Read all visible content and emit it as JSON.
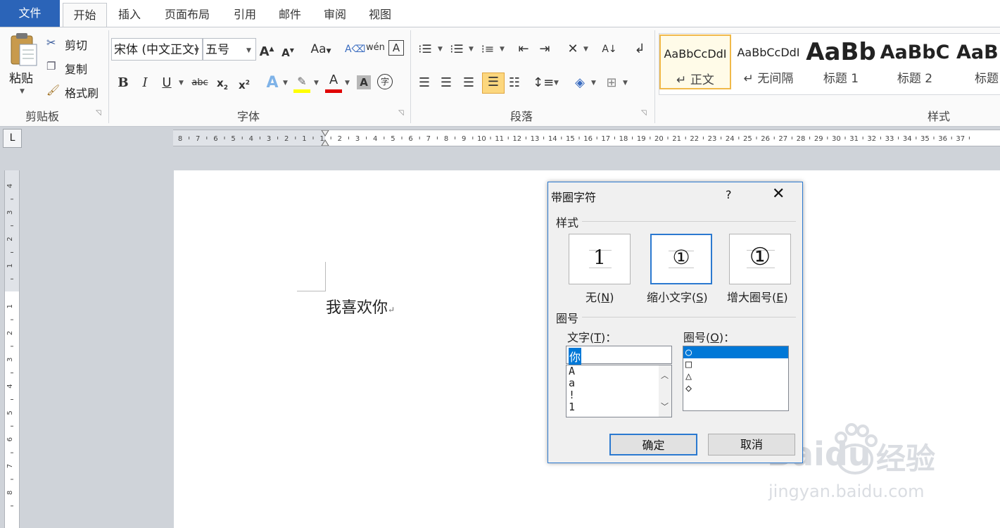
{
  "tabs": [
    "文件",
    "开始",
    "插入",
    "页面布局",
    "引用",
    "邮件",
    "审阅",
    "视图"
  ],
  "clipboard": {
    "paste": "粘贴",
    "cut": "剪切",
    "copy": "复制",
    "format_painter": "格式刷",
    "group": "剪贴板"
  },
  "font": {
    "name": "宋体 (中文正文)",
    "size": "五号",
    "group": "字体"
  },
  "paragraph": {
    "group": "段落"
  },
  "styles": {
    "group": "样式",
    "items": [
      {
        "preview": "AaBbCcDdI",
        "name": "↵ 正文"
      },
      {
        "preview": "AaBbCcDdI",
        "name": "↵ 无间隔"
      },
      {
        "preview": "AaBb",
        "name": "标题 1"
      },
      {
        "preview": "AaBbC",
        "name": "标题 2"
      },
      {
        "preview": "AaBl",
        "name": "标题"
      }
    ]
  },
  "ruler": {
    "h_labels": [
      "8",
      "7",
      "6",
      "5",
      "4",
      "3",
      "2",
      "1",
      "1",
      "2",
      "3",
      "4",
      "5",
      "6",
      "7",
      "8",
      "9",
      "10",
      "11",
      "12",
      "13",
      "14",
      "15",
      "16",
      "17",
      "18",
      "19",
      "20",
      "21",
      "22",
      "23",
      "24",
      "25",
      "26",
      "27",
      "28",
      "29",
      "30",
      "31",
      "32",
      "33",
      "34",
      "35",
      "36",
      "37"
    ],
    "v_labels": [
      "4",
      "3",
      "2",
      "1",
      "1",
      "2",
      "3",
      "4",
      "5",
      "6",
      "7",
      "8"
    ],
    "tab_selector": "L"
  },
  "document": {
    "text": "我喜欢你",
    "para_mark": "↵"
  },
  "dialog": {
    "title": "带圈字符",
    "help": "?",
    "close": "✕",
    "style_section": "样式",
    "style_options": [
      {
        "label": "无",
        "key": "N",
        "glyph": "1"
      },
      {
        "label": "缩小文字",
        "key": "S",
        "glyph": "①"
      },
      {
        "label": "增大圈号",
        "key": "E",
        "glyph": "①"
      }
    ],
    "selected_style": "缩小文字",
    "enclosure_section": "圈号",
    "text_label": "文字",
    "text_key": "T",
    "text_value": "你",
    "text_list": [
      "A",
      "a",
      "!",
      "1"
    ],
    "shape_label": "圈号",
    "shape_key": "O",
    "shapes": [
      "○",
      "□",
      "△",
      "◇"
    ],
    "selected_shape": "○",
    "ok": "确定",
    "cancel": "取消"
  },
  "watermark": {
    "brand": "Baidu",
    "product": "经验",
    "url": "jingyan.baidu.com"
  },
  "colors": {
    "accent": "#2b64b8",
    "selection": "#0078d7",
    "dialog_border": "#2b79d0"
  }
}
